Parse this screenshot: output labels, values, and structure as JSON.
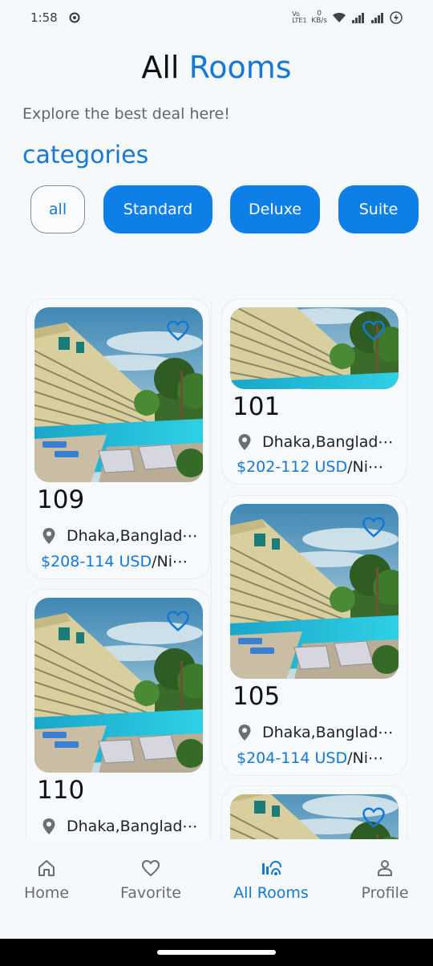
{
  "status_bar": {
    "time": "1:58",
    "net_rate_top": "0",
    "net_rate_unit": "KB/s",
    "network_label": "Vo LTE1"
  },
  "header": {
    "title_part1": "All",
    "title_part2": "Rooms",
    "subtitle": "Explore the best deal here!"
  },
  "categories": {
    "heading": "categories",
    "items": [
      {
        "label": "all",
        "selected": true
      },
      {
        "label": "Standard",
        "selected": false
      },
      {
        "label": "Deluxe",
        "selected": false
      },
      {
        "label": "Suite",
        "selected": false
      }
    ]
  },
  "rooms": [
    {
      "number": "109",
      "location": "Dhaka,Banglad⋯",
      "price": "$208-114 USD",
      "per": "/Ni⋯"
    },
    {
      "number": "101",
      "location": "Dhaka,Banglad⋯",
      "price": "$202-112 USD",
      "per": "/Ni⋯"
    },
    {
      "number": "110",
      "location": "Dhaka,Banglad⋯",
      "price": "",
      "per": ""
    },
    {
      "number": "105",
      "location": "Dhaka,Banglad⋯",
      "price": "$204-114 USD",
      "per": "/Ni⋯"
    },
    {
      "number": "",
      "location": "",
      "price": "",
      "per": ""
    }
  ],
  "bottom_nav": [
    {
      "label": "Home",
      "icon": "home-icon",
      "active": false
    },
    {
      "label": "Favorite",
      "icon": "heart-icon",
      "active": false
    },
    {
      "label": "All Rooms",
      "icon": "rooms-icon",
      "active": true
    },
    {
      "label": "Profile",
      "icon": "person-icon",
      "active": false
    }
  ],
  "colors": {
    "accent": "#1478d6",
    "chip": "#0f7fe8",
    "background": "#f5f9fc"
  }
}
